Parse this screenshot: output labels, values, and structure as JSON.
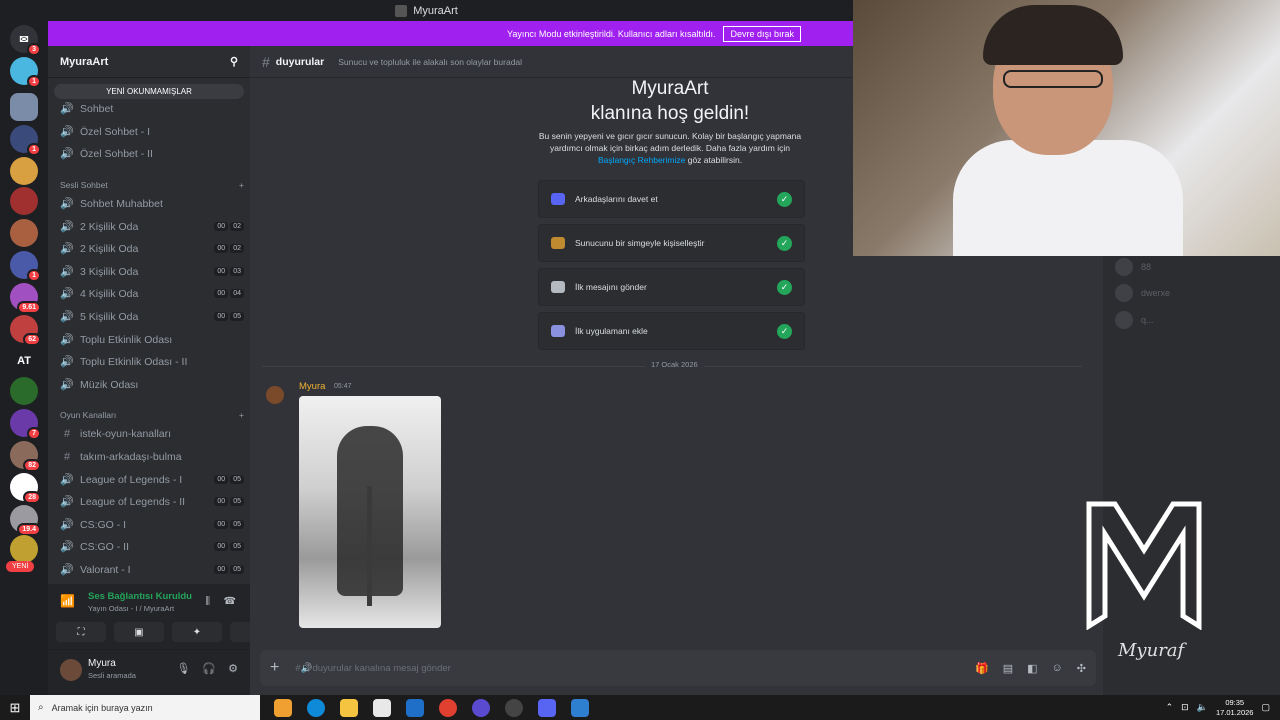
{
  "window": {
    "title": "MyuraArt"
  },
  "banner": {
    "text": "Yayıncı Modu etkinleştirildi. Kullanıcı adları kısaltıldı.",
    "button": "Devre dışı bırak"
  },
  "rail": {
    "badges": [
      "3",
      "1",
      "1",
      "1",
      "9.61",
      "62",
      "7",
      "82",
      "28",
      "19.4"
    ],
    "letters_server": "AT",
    "new_pill": "YENİ"
  },
  "sidebar": {
    "server_name": "MyuraArt",
    "unread_pill": "YENİ OKUNMAMIŞLAR",
    "text_channels": [
      "Sohbet",
      "Özel Sohbet - I",
      "Özel Sohbet - II"
    ],
    "voice_category": "Sesli Sohbet",
    "voice_channels": [
      {
        "name": "Sohbet Muhabbet",
        "c1": "",
        "c2": ""
      },
      {
        "name": "2 Kişilik Oda",
        "c1": "00",
        "c2": "02"
      },
      {
        "name": "2 Kişilik Oda",
        "c1": "00",
        "c2": "02"
      },
      {
        "name": "3 Kişilik Oda",
        "c1": "00",
        "c2": "03"
      },
      {
        "name": "4 Kişilik Oda",
        "c1": "00",
        "c2": "04"
      },
      {
        "name": "5 Kişilik Oda",
        "c1": "00",
        "c2": "05"
      },
      {
        "name": "Toplu Etkinlik Odası",
        "c1": "",
        "c2": ""
      },
      {
        "name": "Toplu Etkinlik Odası - II",
        "c1": "",
        "c2": ""
      },
      {
        "name": "Müzik Odası",
        "c1": "",
        "c2": ""
      }
    ],
    "game_category": "Oyun Kanalları",
    "game_text_channels": [
      "istek-oyun-kanalları",
      "takım-arkadaşı-bulma"
    ],
    "game_voice_channels": [
      {
        "name": "League of Legends - I",
        "c1": "00",
        "c2": "05"
      },
      {
        "name": "League of Legends - II",
        "c1": "00",
        "c2": "05"
      },
      {
        "name": "CS:GO - I",
        "c1": "00",
        "c2": "05"
      },
      {
        "name": "CS:GO - II",
        "c1": "00",
        "c2": "05"
      },
      {
        "name": "Valorant - I",
        "c1": "00",
        "c2": "05"
      }
    ]
  },
  "voice_panel": {
    "status": "Ses Bağlantısı Kuruldu",
    "location": "Yayın Odası - I / MyuraArt"
  },
  "user_panel": {
    "name": "Myura",
    "status": "Sesli aramada"
  },
  "channel": {
    "name": "duyurular",
    "topic": "Sunucu ve topluluk ile alakalı son olaylar buradal"
  },
  "welcome": {
    "title_line1": "MyuraArt",
    "title_line2": "klanına hoş geldin!",
    "desc": "Bu senin yepyeni ve gıcır gıcır sunucun. Kolay bir başlangıç yapmana yardımcı olmak için birkaç adım derledik. Daha fazla yardım için",
    "link": "Başlangıç Rehberimize",
    "desc_end": "göz atabilirsin.",
    "tasks": [
      "Arkadaşlarını davet et",
      "Sunucunu bir simgeyle kişiselleştir",
      "İlk mesajını gönder",
      "İlk uygulamanı ekle"
    ]
  },
  "date_divider": "17 Ocak 2026",
  "message": {
    "author": "Myura",
    "time": "05:47"
  },
  "composer": {
    "placeholder": "#🔊duyurular kanalına mesaj gönder"
  },
  "members": [
    "88",
    "dwerxe",
    "q..."
  ],
  "signature": "Myuraf",
  "taskbar": {
    "search_placeholder": "Aramak için buraya yazın",
    "time": "09:35",
    "date": "17.01.2026"
  }
}
